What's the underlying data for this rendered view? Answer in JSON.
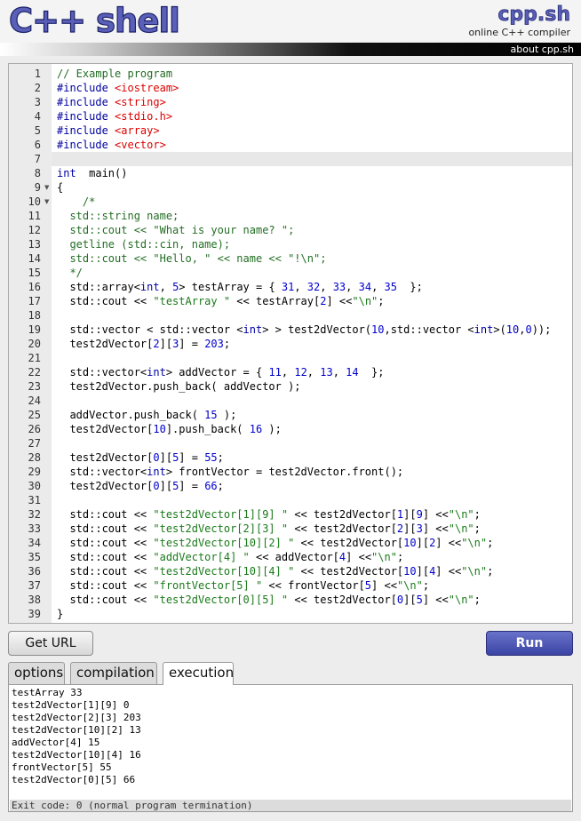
{
  "header": {
    "logo": "C++ shell",
    "brand": "cpp.sh",
    "tagline": "online C++ compiler",
    "about_link": "about cpp.sh"
  },
  "editor": {
    "lines": [
      {
        "no": "1",
        "code": [
          [
            "c",
            "// Example program"
          ]
        ]
      },
      {
        "no": "2",
        "code": [
          [
            "k",
            "#include "
          ],
          [
            "s",
            "<iostream>"
          ]
        ]
      },
      {
        "no": "3",
        "code": [
          [
            "k",
            "#include "
          ],
          [
            "s",
            "<string>"
          ]
        ]
      },
      {
        "no": "4",
        "code": [
          [
            "k",
            "#include "
          ],
          [
            "s",
            "<stdio.h>"
          ]
        ]
      },
      {
        "no": "5",
        "code": [
          [
            "k",
            "#include "
          ],
          [
            "s",
            "<array>"
          ]
        ]
      },
      {
        "no": "6",
        "code": [
          [
            "k",
            "#include "
          ],
          [
            "s",
            "<vector>"
          ]
        ]
      },
      {
        "no": "7",
        "code": []
      },
      {
        "no": "8",
        "code": [
          [
            "k",
            "int"
          ],
          [
            "",
            "  main()"
          ]
        ]
      },
      {
        "no": "9",
        "code": [
          [
            "",
            "{"
          ]
        ]
      },
      {
        "no": "10",
        "code": [
          [
            "c",
            "    /*"
          ]
        ]
      },
      {
        "no": "11",
        "code": [
          [
            "c",
            "  std::string name;"
          ]
        ]
      },
      {
        "no": "12",
        "code": [
          [
            "c",
            "  std::cout << \"What is your name? \";"
          ]
        ]
      },
      {
        "no": "13",
        "code": [
          [
            "c",
            "  getline (std::cin, name);"
          ]
        ]
      },
      {
        "no": "14",
        "code": [
          [
            "c",
            "  std::cout << \"Hello, \" << name << \"!\\n\";"
          ]
        ]
      },
      {
        "no": "15",
        "code": [
          [
            "c",
            "  */"
          ]
        ]
      },
      {
        "no": "16",
        "code": [
          [
            "",
            "  std::array<"
          ],
          [
            "k",
            "int"
          ],
          [
            "",
            ", "
          ],
          [
            "n",
            "5"
          ],
          [
            "",
            "> testArray = { "
          ],
          [
            "n",
            "31"
          ],
          [
            "",
            ", "
          ],
          [
            "n",
            "32"
          ],
          [
            "",
            ", "
          ],
          [
            "n",
            "33"
          ],
          [
            "",
            ", "
          ],
          [
            "n",
            "34"
          ],
          [
            "",
            ", "
          ],
          [
            "n",
            "35"
          ],
          [
            "",
            "  };"
          ]
        ]
      },
      {
        "no": "17",
        "code": [
          [
            "",
            "  std::cout << "
          ],
          [
            "st",
            "\"testArray \""
          ],
          [
            "",
            " << testArray["
          ],
          [
            "n",
            "2"
          ],
          [
            "",
            "] <<"
          ],
          [
            "st",
            "\"\\n\""
          ],
          [
            "",
            ";"
          ]
        ]
      },
      {
        "no": "18",
        "code": []
      },
      {
        "no": "19",
        "code": [
          [
            "",
            "  std::vector < std::vector <"
          ],
          [
            "k",
            "int"
          ],
          [
            "",
            "> > test2dVector("
          ],
          [
            "n",
            "10"
          ],
          [
            "",
            ",std::vector <"
          ],
          [
            "k",
            "int"
          ],
          [
            "",
            ">("
          ],
          [
            "n",
            "10"
          ],
          [
            "",
            ","
          ],
          [
            "n",
            "0"
          ],
          [
            "",
            "));"
          ]
        ]
      },
      {
        "no": "20",
        "code": [
          [
            "",
            "  test2dVector["
          ],
          [
            "n",
            "2"
          ],
          [
            "",
            "]["
          ],
          [
            "n",
            "3"
          ],
          [
            "",
            "] = "
          ],
          [
            "n",
            "203"
          ],
          [
            "",
            ";"
          ]
        ]
      },
      {
        "no": "21",
        "code": []
      },
      {
        "no": "22",
        "code": [
          [
            "",
            "  std::vector<"
          ],
          [
            "k",
            "int"
          ],
          [
            "",
            "> addVector = { "
          ],
          [
            "n",
            "11"
          ],
          [
            "",
            ", "
          ],
          [
            "n",
            "12"
          ],
          [
            "",
            ", "
          ],
          [
            "n",
            "13"
          ],
          [
            "",
            ", "
          ],
          [
            "n",
            "14"
          ],
          [
            "",
            "  };"
          ]
        ]
      },
      {
        "no": "23",
        "code": [
          [
            "",
            "  test2dVector.push_back( addVector );"
          ]
        ]
      },
      {
        "no": "24",
        "code": []
      },
      {
        "no": "25",
        "code": [
          [
            "",
            "  addVector.push_back( "
          ],
          [
            "n",
            "15"
          ],
          [
            "",
            " );"
          ]
        ]
      },
      {
        "no": "26",
        "code": [
          [
            "",
            "  test2dVector["
          ],
          [
            "n",
            "10"
          ],
          [
            "",
            "].push_back( "
          ],
          [
            "n",
            "16"
          ],
          [
            "",
            " );"
          ]
        ]
      },
      {
        "no": "27",
        "code": []
      },
      {
        "no": "28",
        "code": [
          [
            "",
            "  test2dVector["
          ],
          [
            "n",
            "0"
          ],
          [
            "",
            "]["
          ],
          [
            "n",
            "5"
          ],
          [
            "",
            "] = "
          ],
          [
            "n",
            "55"
          ],
          [
            "",
            ";"
          ]
        ]
      },
      {
        "no": "29",
        "code": [
          [
            "",
            "  std::vector<"
          ],
          [
            "k",
            "int"
          ],
          [
            "",
            "> frontVector = test2dVector.front();"
          ]
        ]
      },
      {
        "no": "30",
        "code": [
          [
            "",
            "  test2dVector["
          ],
          [
            "n",
            "0"
          ],
          [
            "",
            "]["
          ],
          [
            "n",
            "5"
          ],
          [
            "",
            "] = "
          ],
          [
            "n",
            "66"
          ],
          [
            "",
            ";"
          ]
        ]
      },
      {
        "no": "31",
        "code": []
      },
      {
        "no": "32",
        "code": [
          [
            "",
            "  std::cout << "
          ],
          [
            "st",
            "\"test2dVector[1][9] \""
          ],
          [
            "",
            " << test2dVector["
          ],
          [
            "n",
            "1"
          ],
          [
            "",
            "]["
          ],
          [
            "n",
            "9"
          ],
          [
            "",
            "] <<"
          ],
          [
            "st",
            "\"\\n\""
          ],
          [
            "",
            ";"
          ]
        ]
      },
      {
        "no": "33",
        "code": [
          [
            "",
            "  std::cout << "
          ],
          [
            "st",
            "\"test2dVector[2][3] \""
          ],
          [
            "",
            " << test2dVector["
          ],
          [
            "n",
            "2"
          ],
          [
            "",
            "]["
          ],
          [
            "n",
            "3"
          ],
          [
            "",
            "] <<"
          ],
          [
            "st",
            "\"\\n\""
          ],
          [
            "",
            ";"
          ]
        ]
      },
      {
        "no": "34",
        "code": [
          [
            "",
            "  std::cout << "
          ],
          [
            "st",
            "\"test2dVector[10][2] \""
          ],
          [
            "",
            " << test2dVector["
          ],
          [
            "n",
            "10"
          ],
          [
            "",
            "]["
          ],
          [
            "n",
            "2"
          ],
          [
            "",
            "] <<"
          ],
          [
            "st",
            "\"\\n\""
          ],
          [
            "",
            ";"
          ]
        ]
      },
      {
        "no": "35",
        "code": [
          [
            "",
            "  std::cout << "
          ],
          [
            "st",
            "\"addVector[4] \""
          ],
          [
            "",
            " << addVector["
          ],
          [
            "n",
            "4"
          ],
          [
            "",
            "] <<"
          ],
          [
            "st",
            "\"\\n\""
          ],
          [
            "",
            ";"
          ]
        ]
      },
      {
        "no": "36",
        "code": [
          [
            "",
            "  std::cout << "
          ],
          [
            "st",
            "\"test2dVector[10][4] \""
          ],
          [
            "",
            " << test2dVector["
          ],
          [
            "n",
            "10"
          ],
          [
            "",
            "]["
          ],
          [
            "n",
            "4"
          ],
          [
            "",
            "] <<"
          ],
          [
            "st",
            "\"\\n\""
          ],
          [
            "",
            ";"
          ]
        ]
      },
      {
        "no": "37",
        "code": [
          [
            "",
            "  std::cout << "
          ],
          [
            "st",
            "\"frontVector[5] \""
          ],
          [
            "",
            " << frontVector["
          ],
          [
            "n",
            "5"
          ],
          [
            "",
            "] <<"
          ],
          [
            "st",
            "\"\\n\""
          ],
          [
            "",
            ";"
          ]
        ]
      },
      {
        "no": "38",
        "code": [
          [
            "",
            "  std::cout << "
          ],
          [
            "st",
            "\"test2dVector[0][5] \""
          ],
          [
            "",
            " << test2dVector["
          ],
          [
            "n",
            "0"
          ],
          [
            "",
            "]["
          ],
          [
            "n",
            "5"
          ],
          [
            "",
            "] <<"
          ],
          [
            "st",
            "\"\\n\""
          ],
          [
            "",
            ";"
          ]
        ]
      },
      {
        "no": "39",
        "code": [
          [
            "",
            "}"
          ]
        ]
      }
    ],
    "fold_marks": [
      "9",
      "10"
    ]
  },
  "buttons": {
    "get_url": "Get URL",
    "run": "Run"
  },
  "tabs": [
    {
      "label": "options",
      "active": false
    },
    {
      "label": "compilation",
      "active": false
    },
    {
      "label": "execution",
      "active": true
    }
  ],
  "output": {
    "lines": [
      "testArray 33",
      "test2dVector[1][9] 0",
      "test2dVector[2][3] 203",
      "test2dVector[10][2] 13",
      "addVector[4] 15",
      "test2dVector[10][4] 16",
      "frontVector[5] 55",
      "test2dVector[0][5] 66"
    ],
    "exit": "Exit code: 0 (normal program termination)"
  }
}
